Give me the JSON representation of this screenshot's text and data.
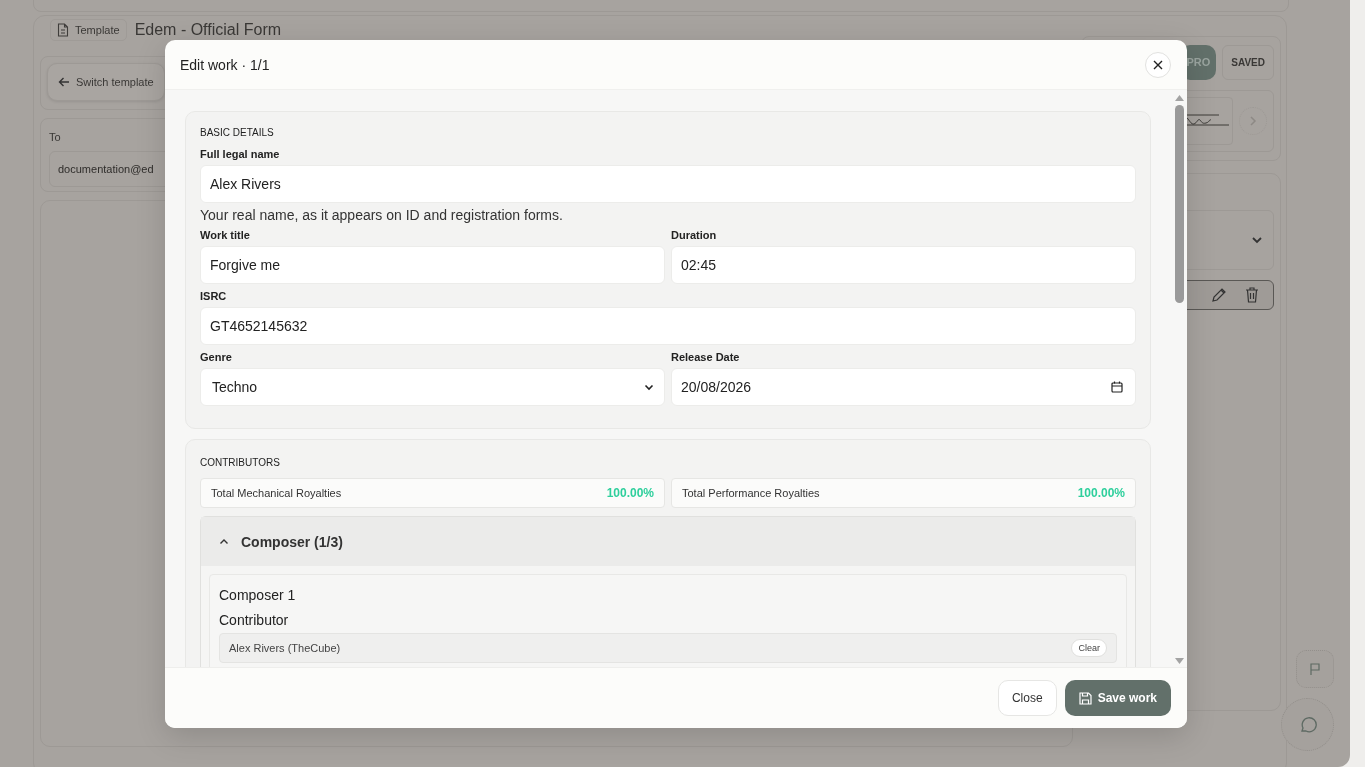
{
  "background": {
    "template_badge": "Template",
    "form_title": "Edem - Official Form",
    "switch_button": "Switch template",
    "recipient": {
      "label": "To",
      "value": "documentation@ed"
    },
    "plan_badge": "PRO",
    "save_status": "SAVED"
  },
  "modal": {
    "title": "Edit work · 1/1",
    "basic": {
      "heading": "BASIC DETAILS",
      "rows": [
        [
          {
            "kind": "text",
            "label": "Full legal name",
            "value": "Alex Rivers",
            "help": "Your real name, as it appears on ID and registration forms."
          }
        ],
        [
          {
            "kind": "text",
            "label": "Work title",
            "value": "Forgive me"
          },
          {
            "kind": "text",
            "label": "Duration",
            "value": "02:45"
          }
        ],
        [
          {
            "kind": "text",
            "label": "ISRC",
            "value": "GT4652145632"
          }
        ],
        [
          {
            "kind": "select",
            "label": "Genre",
            "value": "Techno"
          },
          {
            "kind": "date",
            "label": "Release Date",
            "value": "20/08/2026"
          }
        ]
      ]
    },
    "contributors": {
      "heading": "CONTRIBUTORS",
      "totals": [
        {
          "label": "Total Mechanical Royalties",
          "value": "100.00%"
        },
        {
          "label": "Total Performance Royalties",
          "value": "100.00%"
        }
      ],
      "groups": [
        {
          "title": "Composer (1/3)",
          "expanded": true,
          "entries": [
            {
              "title": "Composer 1",
              "field_label": "Contributor",
              "value": "Alex Rivers (TheCube)",
              "action": "Clear"
            }
          ]
        }
      ]
    },
    "buttons": [
      {
        "kind": "secondary",
        "label": "Close"
      },
      {
        "kind": "primary",
        "label": "Save work"
      }
    ]
  }
}
